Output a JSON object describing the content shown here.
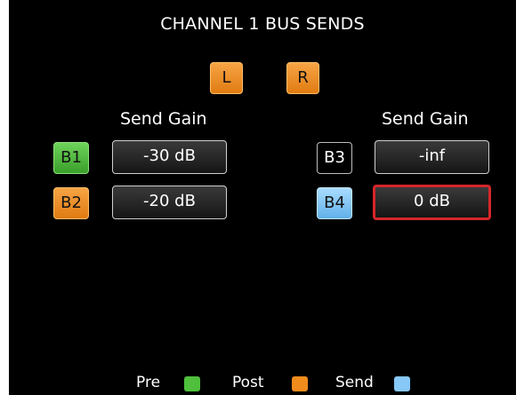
{
  "header": {
    "title": "CHANNEL 1 BUS SENDS"
  },
  "pan": {
    "left_label": "L",
    "right_label": "R"
  },
  "left_column": {
    "heading": "Send Gain",
    "rows": [
      {
        "bus": "B1",
        "gain": "-30 dB",
        "mode": "pre"
      },
      {
        "bus": "B2",
        "gain": "-20 dB",
        "mode": "post"
      }
    ]
  },
  "right_column": {
    "heading": "Send Gain",
    "rows": [
      {
        "bus": "B3",
        "gain": "-inf",
        "mode": "off"
      },
      {
        "bus": "B4",
        "gain": "0 dB",
        "mode": "send",
        "selected": true
      }
    ]
  },
  "legend": {
    "pre_label": "Pre",
    "pre_color": "#4fbf3c",
    "post_label": "Post",
    "post_color": "#f08c1c",
    "send_label": "Send",
    "send_color": "#86c8f6"
  },
  "colors": {
    "selection_border": "#d6262a",
    "background": "#000000"
  }
}
